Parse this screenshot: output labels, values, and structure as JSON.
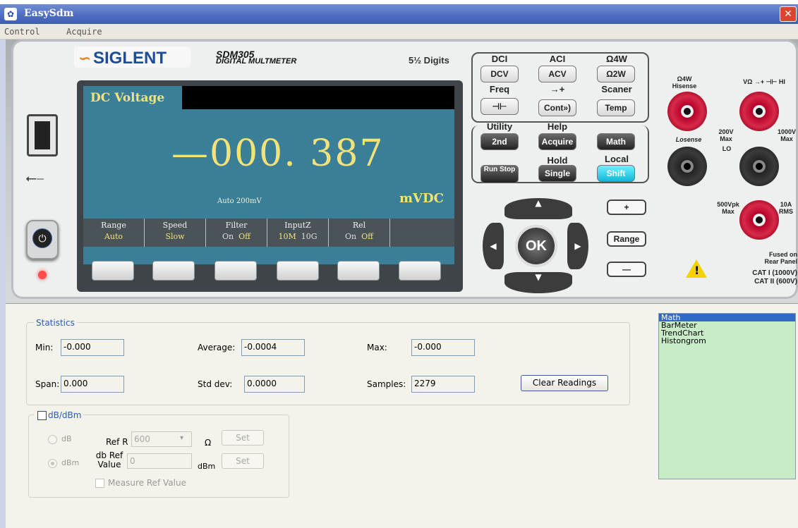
{
  "window": {
    "title": "EasySdm",
    "close_glyph": "✕"
  },
  "menu": [
    "Control",
    "Acquire"
  ],
  "instrument": {
    "brand": "SIGLENT",
    "model": "SDM305",
    "model_sub": "DIGITAL MULTMETER",
    "digits": "5½ Digits",
    "screen": {
      "mode": "DC Voltage",
      "reading": "—000. 387",
      "range": "Auto 200mV",
      "unit": "mVDC",
      "softkeys": [
        {
          "name": "Range",
          "value": "Auto",
          "value2": ""
        },
        {
          "name": "Speed",
          "value": "Slow",
          "value2": ""
        },
        {
          "name": "Filter",
          "value": "On",
          "value2": "Off"
        },
        {
          "name": "InputZ",
          "value": "10M",
          "value2": "10G"
        },
        {
          "name": "Rel",
          "value": "On",
          "value2": "Off"
        },
        {
          "name": "",
          "value": "",
          "value2": ""
        }
      ]
    },
    "keys": {
      "dci": "DCI",
      "aci": "ACI",
      "o4w": "Ω4W",
      "dcv": "DCV",
      "acv": "ACV",
      "o2w": "Ω2W",
      "freq": "Freq",
      "diode": "→+",
      "scaner": "Scaner",
      "cap": "⊣⊢",
      "cont": "Cont»)",
      "temp": "Temp",
      "utility": "Utility",
      "help": "Help",
      "second": "2nd",
      "acquire": "Acquire",
      "math": "Math",
      "hold": "Hold",
      "local": "Local",
      "runstop": "Run Stop",
      "single": "Single",
      "shift": "Shift",
      "ok": "OK",
      "plus": "+",
      "range": "Range",
      "minus": "—"
    },
    "terminals": {
      "hisense": "Ω4W Hisense",
      "hi": "VΩ →+ ⊣⊢ HI",
      "losense": "Losense",
      "v200": "200V Max",
      "v1000": "1000V Max",
      "lo": "LO",
      "vpk": "500Vpk Max",
      "amp": "10A RMS",
      "fused1": "Fused on",
      "fused2": "Rear Panel",
      "cat1": "CAT I (1000V)",
      "cat2": "CAT II (600V)"
    }
  },
  "statistics": {
    "legend": "Statistics",
    "min_label": "Min:",
    "min": "-0.000",
    "avg_label": "Average:",
    "avg": "-0.0004",
    "max_label": "Max:",
    "max": "-0.000",
    "span_label": "Span:",
    "span": "0.000",
    "std_label": "Std dev:",
    "std": "0.0000",
    "samples_label": "Samples:",
    "samples": "2279",
    "clear_button": "Clear Readings"
  },
  "db": {
    "legend": "dB/dBm",
    "db_radio": "dB",
    "dbm_radio": "dBm",
    "refr_label": "Ref R",
    "refr_value": "600",
    "ohm": "Ω",
    "set1": "Set",
    "dbref_label1": "db Ref",
    "dbref_label2": "Value",
    "dbref_value": "0",
    "dbm_unit": "dBm",
    "set2": "Set",
    "measure_ref": "Measure Ref Value"
  },
  "views": [
    "Math",
    "BarMeter",
    "TrendChart",
    "Histongrom"
  ],
  "selected_view": "Math"
}
